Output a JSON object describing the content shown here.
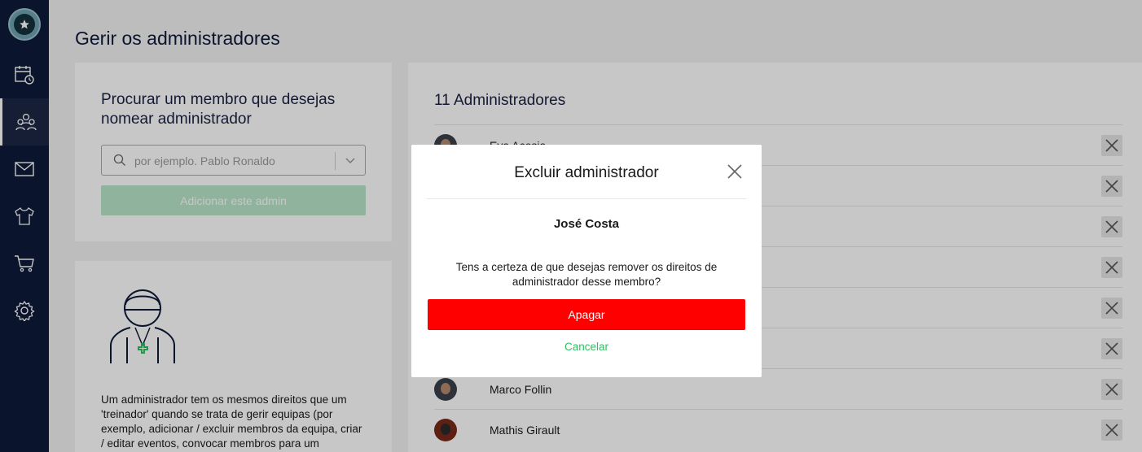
{
  "app": {
    "title": "Gerir os administradores"
  },
  "colors": {
    "sidebar": "#0e1a3a",
    "accent_green": "#2ec060",
    "danger": "#ff0000"
  },
  "sidebar": {
    "items": [
      {
        "icon": "calendar-icon",
        "active": false
      },
      {
        "icon": "team-icon",
        "active": true
      },
      {
        "icon": "mail-icon",
        "active": false
      },
      {
        "icon": "shirt-icon",
        "active": false
      },
      {
        "icon": "cart-icon",
        "active": false
      },
      {
        "icon": "gear-icon",
        "active": false
      }
    ]
  },
  "search": {
    "heading": "Procurar um membro que desejas nomear administrador",
    "placeholder": "por ejemplo. Pablo Ronaldo",
    "add_label": "Adicionar este admin"
  },
  "info": {
    "text": "Um administrador tem os mesmos direitos que um 'treinador' quando se trata de gerir equipas (por exemplo, adicionar / excluir membros da equipa, criar / editar eventos, convocar membros para um"
  },
  "admins": {
    "heading": "11 Administradores",
    "rows": [
      {
        "name": "Eva Acosia"
      },
      {
        "name": ""
      },
      {
        "name": ""
      },
      {
        "name": ""
      },
      {
        "name": ""
      },
      {
        "name": ""
      },
      {
        "name": "Marco Follin"
      },
      {
        "name": "Mathis Girault"
      }
    ]
  },
  "modal": {
    "title": "Excluir administrador",
    "member": "José Costa",
    "question": "Tens a certeza de que desejas remover os direitos de administrador desse membro?",
    "confirm_label": "Apagar",
    "cancel_label": "Cancelar"
  }
}
